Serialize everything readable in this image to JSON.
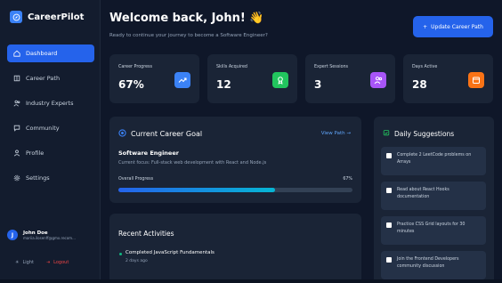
{
  "brand": {
    "name": "CareerPilot"
  },
  "sidebar": {
    "items": [
      {
        "label": "Dashboard",
        "icon": "home-icon",
        "active": true
      },
      {
        "label": "Career Path",
        "icon": "book-icon"
      },
      {
        "label": "Industry Experts",
        "icon": "users-icon"
      },
      {
        "label": "Community",
        "icon": "chat-icon"
      },
      {
        "label": "Profile",
        "icon": "user-icon"
      },
      {
        "label": "Settings",
        "icon": "gear-icon"
      }
    ]
  },
  "user": {
    "initial": "J",
    "name": "John Doe",
    "email": "mariia.ilosenff@gmx.recom..."
  },
  "footer": {
    "light_label": "Light",
    "logout_label": "Logout"
  },
  "header": {
    "title": "Welcome back, John!",
    "emoji": "👋",
    "subtitle": "Ready to continue your journey to become a Software Engineer?",
    "update_label": "Update Career Path"
  },
  "stats": [
    {
      "label": "Career Progress",
      "value": "67%",
      "icon": "trend-icon",
      "color": "#3b82f6"
    },
    {
      "label": "Skills Acquired",
      "value": "12",
      "icon": "award-icon",
      "color": "#22c55e"
    },
    {
      "label": "Expert Sessions",
      "value": "3",
      "icon": "users-icon",
      "color": "#a855f7"
    },
    {
      "label": "Days Active",
      "value": "28",
      "icon": "calendar-icon",
      "color": "#f97316"
    }
  ],
  "goal": {
    "heading": "Current Career Goal",
    "view_label": "View Path →",
    "role": "Software Engineer",
    "focus": "Current focus: Full-stack web development with React and Node.js",
    "progress_label": "Overall Progress",
    "progress_text": "67%",
    "progress": 0.67
  },
  "activities": {
    "heading": "Recent Activities",
    "items": [
      {
        "name": "Completed JavaScript Fundamentals",
        "time": "2 days ago"
      }
    ]
  },
  "suggestions": {
    "heading": "Daily Suggestions",
    "items": [
      "Complete 2 LeetCode problems on Arrays",
      "Read about React Hooks documentation",
      "Practice CSS Grid layouts for 30 minutes",
      "Join the Frontend Developers community discussion"
    ]
  }
}
